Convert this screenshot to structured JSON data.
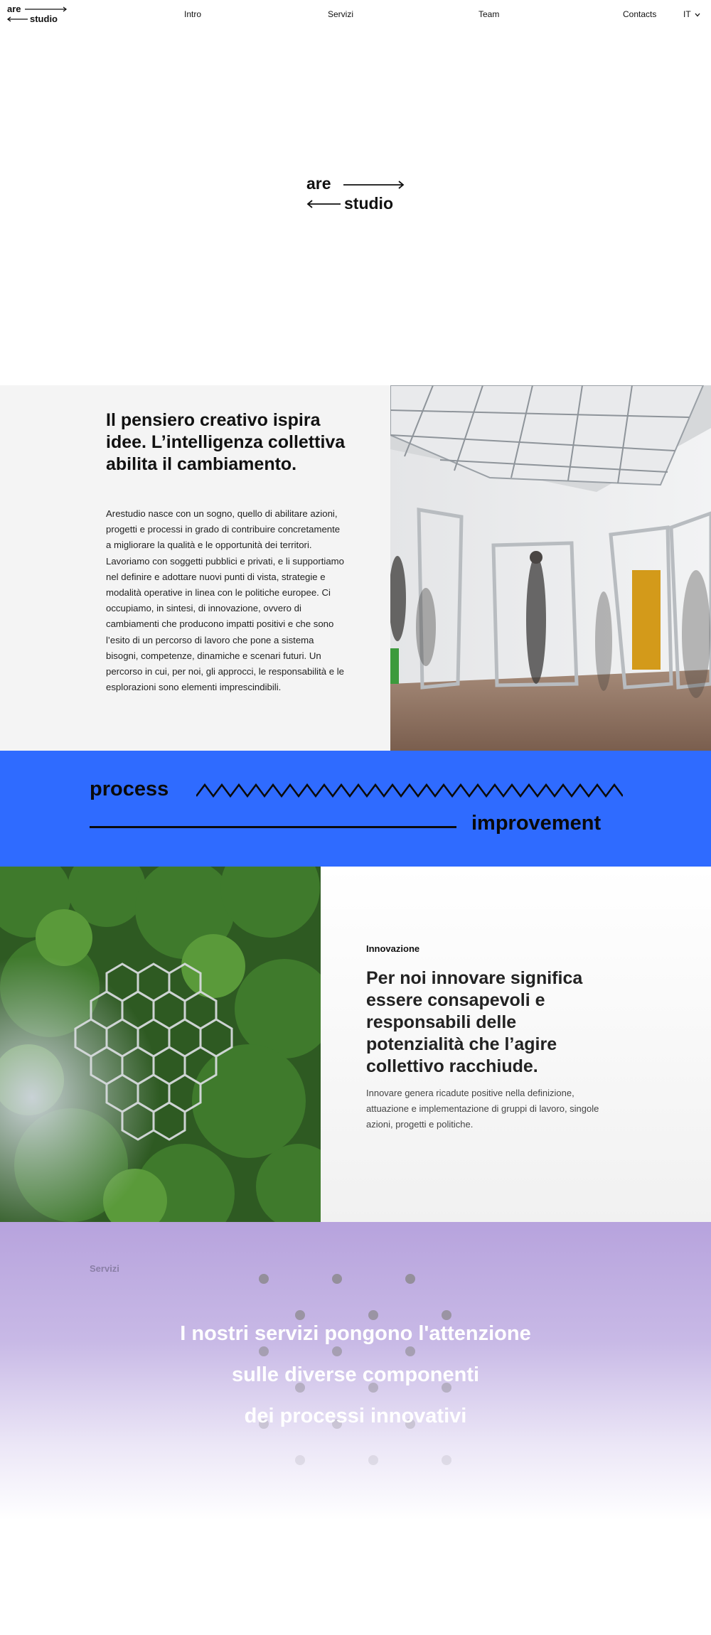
{
  "header": {
    "logo": {
      "line1": "are",
      "line2": "studio"
    },
    "nav": [
      "Intro",
      "Servizi",
      "Team",
      "Contacts"
    ],
    "language": "IT",
    "language_icon": "chevron-down-icon"
  },
  "hero": {
    "logo": {
      "line1": "are",
      "line2": "studio"
    }
  },
  "intro": {
    "title": "Il pensiero creativo ispira idee. L’intelligenza collettiva abilita il cambiamento.",
    "body": "Arestudio nasce con un sogno, quello di abilitare azioni, progetti e processi in grado di contribuire concretamente a migliorare la qualità e le opportunità dei territori. Lavoriamo con soggetti pubblici e privati, e li supportiamo nel definire e adottare nuovi punti di vista, strategie e modalità operative in linea con le politiche europee. Ci occupiamo, in sintesi, di innovazione, ovvero di cambiamenti che producono impatti positivi e che sono l’esito di un percorso di lavoro che pone a sistema bisogni, competenze, dinamiche e scenari futuri. Un percorso in cui, per noi, gli approcci, le responsabilità e le esplorazioni sono elementi imprescindibili."
  },
  "band": {
    "word1": "process",
    "word2": "improvement",
    "accent": "#2f6bff"
  },
  "innovation": {
    "kicker": "Innovazione",
    "title": "Per noi innovare significa essere consapevoli e responsabili delle potenzialità che l’agire collettivo racchiude.",
    "body": "Innovare genera ricadute positive nella definizione, attuazione e implementazione di gruppi di lavoro, singole azioni, progetti e politiche."
  },
  "services": {
    "kicker": "Servizi",
    "lines": [
      "I nostri servizi pongono l'attenzione",
      "sulle diverse componenti",
      "dei processi innovativi"
    ]
  }
}
